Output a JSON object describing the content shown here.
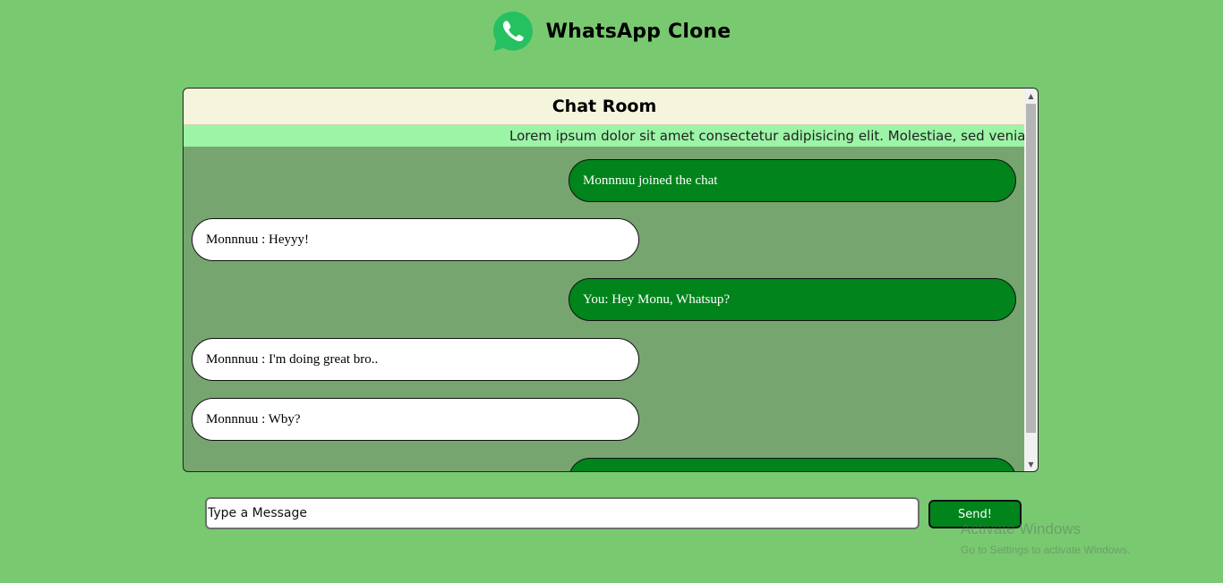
{
  "header": {
    "logo_icon": "whatsapp-logo-icon",
    "title": "WhatsApp Clone"
  },
  "chat": {
    "room_title": "Chat Room",
    "marquee": "Lorem ipsum dolor sit amet consectetur adipisicing elit. Molestiae, sed veniam beatae",
    "messages": [
      {
        "position": "right",
        "text": "Monnnuu joined the chat"
      },
      {
        "position": "left",
        "text": "Monnnuu : Heyyy!"
      },
      {
        "position": "right",
        "text": "You: Hey Monu, Whatsup?"
      },
      {
        "position": "left",
        "text": "Monnnuu : I'm doing great bro.."
      },
      {
        "position": "left",
        "text": "Monnnuu : Wby?"
      },
      {
        "position": "right",
        "text": ""
      }
    ]
  },
  "composer": {
    "placeholder": "Type a Message",
    "send_label": "Send!"
  },
  "watermark": {
    "title": "Activate Windows",
    "subtitle": "Go to Settings to activate Windows."
  },
  "colors": {
    "page_background": "#79c971",
    "chat_background": "#77a570",
    "room_header": "#f5f4dc",
    "marquee_background": "#9cf4a6",
    "sent_bubble": "#00841b",
    "received_bubble": "#ffffff",
    "send_button": "#00841b",
    "logo_green": "#25c160"
  }
}
